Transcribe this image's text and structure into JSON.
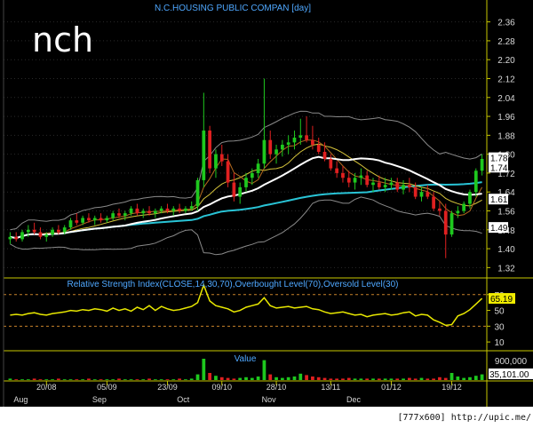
{
  "ticker": "nch",
  "title": "N.C.HOUSING PUBLIC COMPAN [day]",
  "footer": "[777x600] http://upic.me/",
  "chart_data": {
    "type": "candlestick",
    "price_ticks": [
      "2.36",
      "2.28",
      "2.20",
      "2.12",
      "2.04",
      "1.96",
      "1.88",
      "1.80",
      "1.72",
      "1.64",
      "1.56",
      "1.48",
      "1.40",
      "1.32"
    ],
    "price_range": [
      1.28,
      2.4
    ],
    "price_markers": [
      {
        "label": "1.78",
        "value": 1.785,
        "bg": "#ffffff",
        "fg": "#000000"
      },
      {
        "label": "1.74",
        "value": 1.745,
        "bg": "#ffffff",
        "fg": "#000000"
      },
      {
        "label": "1.61",
        "value": 1.61,
        "bg": "#ffffff",
        "fg": "#000000"
      },
      {
        "label": "1.49",
        "value": 1.49,
        "bg": "#ffffff",
        "fg": "#000000"
      }
    ],
    "candles": [
      [
        1.44,
        1.47,
        1.42,
        1.45
      ],
      [
        1.45,
        1.47,
        1.43,
        1.44
      ],
      [
        1.44,
        1.48,
        1.43,
        1.47
      ],
      [
        1.47,
        1.5,
        1.45,
        1.48
      ],
      [
        1.48,
        1.51,
        1.46,
        1.47
      ],
      [
        1.47,
        1.49,
        1.44,
        1.45
      ],
      [
        1.45,
        1.47,
        1.43,
        1.46
      ],
      [
        1.46,
        1.49,
        1.45,
        1.48
      ],
      [
        1.48,
        1.5,
        1.46,
        1.47
      ],
      [
        1.47,
        1.5,
        1.46,
        1.49
      ],
      [
        1.49,
        1.53,
        1.48,
        1.52
      ],
      [
        1.52,
        1.55,
        1.5,
        1.51
      ],
      [
        1.51,
        1.54,
        1.5,
        1.53
      ],
      [
        1.53,
        1.55,
        1.51,
        1.52
      ],
      [
        1.52,
        1.54,
        1.5,
        1.53
      ],
      [
        1.53,
        1.55,
        1.51,
        1.52
      ],
      [
        1.52,
        1.54,
        1.51,
        1.53
      ],
      [
        1.53,
        1.56,
        1.52,
        1.55
      ],
      [
        1.55,
        1.57,
        1.53,
        1.54
      ],
      [
        1.54,
        1.56,
        1.52,
        1.55
      ],
      [
        1.55,
        1.58,
        1.54,
        1.57
      ],
      [
        1.57,
        1.59,
        1.54,
        1.55
      ],
      [
        1.55,
        1.57,
        1.53,
        1.56
      ],
      [
        1.56,
        1.58,
        1.54,
        1.55
      ],
      [
        1.55,
        1.57,
        1.53,
        1.56
      ],
      [
        1.56,
        1.58,
        1.55,
        1.57
      ],
      [
        1.57,
        1.59,
        1.55,
        1.56
      ],
      [
        1.56,
        1.58,
        1.54,
        1.57
      ],
      [
        1.57,
        1.59,
        1.55,
        1.56
      ],
      [
        1.56,
        1.58,
        1.55,
        1.57
      ],
      [
        1.57,
        1.6,
        1.56,
        1.58
      ],
      [
        1.58,
        1.7,
        1.56,
        1.69
      ],
      [
        1.69,
        2.06,
        1.66,
        1.9
      ],
      [
        1.9,
        1.92,
        1.72,
        1.74
      ],
      [
        1.74,
        1.82,
        1.7,
        1.8
      ],
      [
        1.8,
        1.84,
        1.75,
        1.77
      ],
      [
        1.77,
        1.8,
        1.66,
        1.68
      ],
      [
        1.68,
        1.72,
        1.6,
        1.62
      ],
      [
        1.62,
        1.68,
        1.59,
        1.66
      ],
      [
        1.66,
        1.72,
        1.64,
        1.7
      ],
      [
        1.7,
        1.74,
        1.67,
        1.72
      ],
      [
        1.72,
        1.78,
        1.7,
        1.76
      ],
      [
        1.76,
        2.12,
        1.74,
        1.86
      ],
      [
        1.86,
        1.9,
        1.78,
        1.8
      ],
      [
        1.8,
        1.84,
        1.76,
        1.82
      ],
      [
        1.82,
        1.86,
        1.79,
        1.84
      ],
      [
        1.84,
        1.88,
        1.8,
        1.85
      ],
      [
        1.85,
        1.9,
        1.82,
        1.87
      ],
      [
        1.87,
        1.95,
        1.84,
        1.88
      ],
      [
        1.88,
        1.96,
        1.85,
        1.86
      ],
      [
        1.86,
        1.92,
        1.82,
        1.84
      ],
      [
        1.84,
        1.87,
        1.8,
        1.81
      ],
      [
        1.81,
        1.85,
        1.77,
        1.78
      ],
      [
        1.78,
        1.8,
        1.73,
        1.74
      ],
      [
        1.74,
        1.77,
        1.7,
        1.72
      ],
      [
        1.72,
        1.75,
        1.68,
        1.7
      ],
      [
        1.7,
        1.73,
        1.66,
        1.68
      ],
      [
        1.68,
        1.72,
        1.65,
        1.7
      ],
      [
        1.7,
        1.74,
        1.67,
        1.71
      ],
      [
        1.71,
        1.73,
        1.66,
        1.67
      ],
      [
        1.67,
        1.7,
        1.64,
        1.68
      ],
      [
        1.68,
        1.71,
        1.65,
        1.66
      ],
      [
        1.66,
        1.7,
        1.64,
        1.67
      ],
      [
        1.67,
        1.7,
        1.65,
        1.68
      ],
      [
        1.68,
        1.7,
        1.64,
        1.65
      ],
      [
        1.65,
        1.69,
        1.63,
        1.67
      ],
      [
        1.67,
        1.7,
        1.64,
        1.66
      ],
      [
        1.66,
        1.68,
        1.61,
        1.62
      ],
      [
        1.62,
        1.66,
        1.6,
        1.64
      ],
      [
        1.64,
        1.67,
        1.61,
        1.62
      ],
      [
        1.62,
        1.64,
        1.56,
        1.57
      ],
      [
        1.57,
        1.6,
        1.54,
        1.56
      ],
      [
        1.56,
        1.59,
        1.36,
        1.46
      ],
      [
        1.46,
        1.56,
        1.45,
        1.55
      ],
      [
        1.55,
        1.58,
        1.53,
        1.56
      ],
      [
        1.56,
        1.6,
        1.55,
        1.59
      ],
      [
        1.59,
        1.65,
        1.57,
        1.64
      ],
      [
        1.64,
        1.74,
        1.62,
        1.73
      ],
      [
        1.73,
        1.8,
        1.71,
        1.78
      ]
    ],
    "rsi_title": "Relative Strength Index(CLOSE,14,30,70),Overbought Level(70),Oversold Level(30)",
    "rsi_ticks": [
      "70",
      "50",
      "30",
      "10"
    ],
    "rsi_range": [
      0,
      90
    ],
    "rsi_levels": [
      70,
      30
    ],
    "rsi_last_label": "65.19",
    "rsi_values": [
      44,
      45,
      44,
      46,
      47,
      45,
      44,
      46,
      47,
      48,
      50,
      49,
      51,
      50,
      52,
      51,
      49,
      53,
      50,
      52,
      49,
      54,
      51,
      56,
      50,
      55,
      52,
      50,
      51,
      53,
      55,
      60,
      82,
      62,
      56,
      54,
      52,
      48,
      50,
      54,
      56,
      58,
      66,
      56,
      53,
      54,
      55,
      53,
      54,
      55,
      52,
      51,
      48,
      46,
      47,
      48,
      46,
      44,
      45,
      42,
      44,
      45,
      46,
      44,
      45,
      47,
      48,
      43,
      45,
      44,
      38,
      35,
      31,
      32,
      43,
      46,
      51,
      58,
      65.19
    ],
    "volume_title": "Value",
    "volume_ticks": [
      "900,000"
    ],
    "volume_last_label": "35,101.00",
    "volume_values": [
      2,
      1,
      1,
      1,
      2,
      1,
      1,
      1,
      2,
      1,
      1,
      1,
      1,
      2,
      1,
      1,
      1,
      1,
      2,
      1,
      1,
      1,
      1,
      2,
      1,
      1,
      1,
      1,
      2,
      1,
      2,
      8,
      30,
      10,
      6,
      4,
      3,
      2,
      3,
      4,
      3,
      5,
      28,
      8,
      4,
      3,
      4,
      5,
      9,
      7,
      5,
      4,
      3,
      2,
      2,
      2,
      3,
      2,
      2,
      2,
      2,
      2,
      2,
      2,
      2,
      2,
      3,
      2,
      3,
      2,
      2,
      4,
      3,
      10,
      5,
      3,
      4,
      6,
      8
    ],
    "x_labels": [
      "20/08",
      "05/09",
      "23/09",
      "09/10",
      "28/10",
      "13/11",
      "01/12",
      "19/12"
    ],
    "month_labels": [
      "Aug",
      "Sep",
      "Oct",
      "Nov",
      "Dec"
    ]
  }
}
